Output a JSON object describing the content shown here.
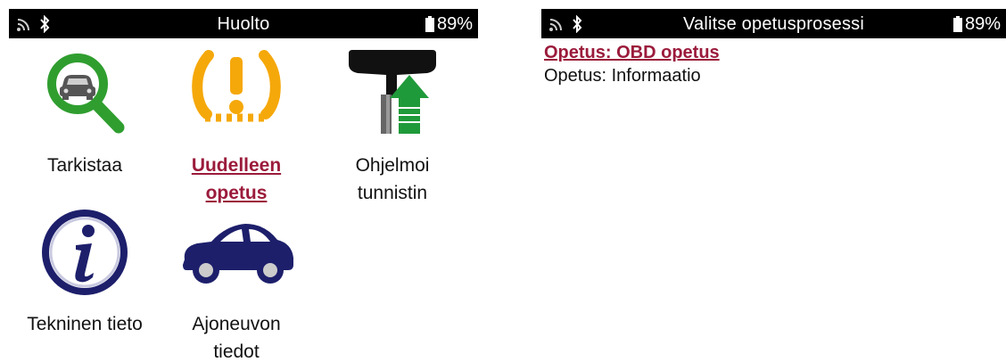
{
  "left_screen": {
    "status": {
      "title": "Huolto",
      "battery": "89%"
    },
    "tiles": [
      {
        "label": "Tarkistaa",
        "icon": "magnifier-car-icon"
      },
      {
        "label_line1": "Uudelleen",
        "label_line2": "opetus",
        "icon": "tpms-warning-icon",
        "selected": true
      },
      {
        "label_line1": "Ohjelmoi",
        "label_line2": "tunnistin",
        "icon": "sensor-program-icon"
      },
      {
        "label": "Tekninen tieto",
        "icon": "info-icon"
      },
      {
        "label_line1": "Ajoneuvon",
        "label_line2": "tiedot",
        "icon": "car-icon"
      }
    ]
  },
  "right_screen": {
    "status": {
      "title": "Valitse opetusprosessi",
      "battery": "89%"
    },
    "menu": [
      {
        "label": "Opetus: OBD opetus",
        "selected": true
      },
      {
        "label": "Opetus: Informaatio",
        "selected": false
      }
    ]
  },
  "colors": {
    "accent": "#9b1b3b",
    "status_bar": "#000000",
    "magnifier_green": "#2f9e2f",
    "tpms_amber": "#f5a80a",
    "arrow_green": "#1f9a3a",
    "navy": "#1d1f6b"
  }
}
